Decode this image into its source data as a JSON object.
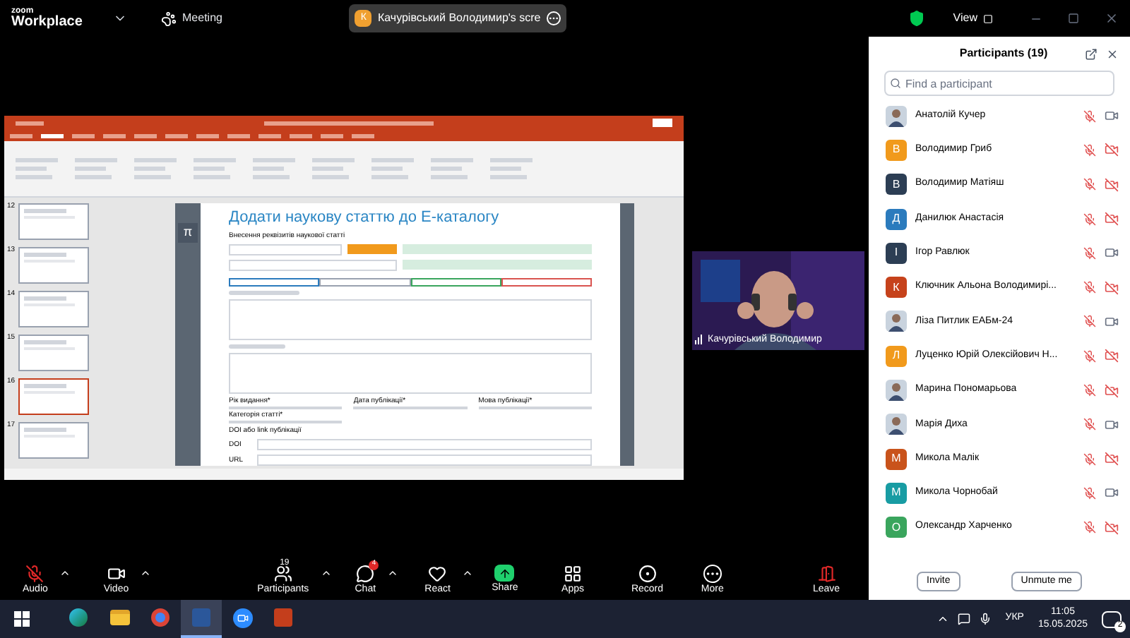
{
  "top_bar": {
    "brand_top": "zoom",
    "brand": "Workplace",
    "meeting_label": "Meeting",
    "share_pill": {
      "letter": "К",
      "label": "Качурівський Володимир's scre"
    },
    "view_label": "View"
  },
  "shared_screen": {
    "thumbnails": [
      {
        "number": "12",
        "selected": false
      },
      {
        "number": "13",
        "selected": false
      },
      {
        "number": "14",
        "selected": false
      },
      {
        "number": "15",
        "selected": false
      },
      {
        "number": "16",
        "selected": true
      },
      {
        "number": "17",
        "selected": false
      }
    ],
    "slide": {
      "icon_glyph": "π",
      "title": "Додати наукову статтю до Е-каталогу",
      "subtitle": "Внесення реквізитів наукової статті",
      "row_labels": [
        "Рік видання*",
        "Дата публікації*",
        "Мова публікації*",
        "Категорія статті*"
      ],
      "doi_heading": "DOI або link публікації",
      "link_labels": [
        "DOI",
        "URL"
      ]
    }
  },
  "video_tile": {
    "name": "Качурівський Володимир"
  },
  "toolbar": [
    {
      "kind": "audio",
      "label": "Audio",
      "muted": true
    },
    {
      "kind": "video",
      "label": "Video"
    },
    {
      "kind": "participants",
      "label": "Participants",
      "count": "19"
    },
    {
      "kind": "chat",
      "label": "Chat",
      "badge": "4"
    },
    {
      "kind": "react",
      "label": "React"
    },
    {
      "kind": "share",
      "label": "Share"
    },
    {
      "kind": "apps",
      "label": "Apps"
    },
    {
      "kind": "record",
      "label": "Record"
    },
    {
      "kind": "more",
      "label": "More"
    },
    {
      "kind": "leave",
      "label": "Leave"
    }
  ],
  "participants": {
    "title": "Participants (19)",
    "search_placeholder": "Find a participant",
    "items": [
      {
        "name": "Анатолій Кучер",
        "muted": true,
        "video_on": true
      },
      {
        "name": "Володимир  Гриб",
        "avatar": {
          "kind": "letter",
          "letter": "В",
          "color": "#f19a1c"
        },
        "muted": true,
        "video_on": false
      },
      {
        "name": "Володимир Матіяш",
        "avatar": {
          "kind": "letter",
          "letter": "В",
          "color": "#2c3e54"
        },
        "muted": true,
        "video_on": false
      },
      {
        "name": "Данилюк Анастасія",
        "avatar": {
          "kind": "letter",
          "letter": "Д",
          "color": "#2b7bbd"
        },
        "muted": true,
        "video_on": false
      },
      {
        "name": "Ігор Равлюк",
        "avatar": {
          "kind": "letter",
          "letter": "І",
          "color": "#2c3e54"
        },
        "muted": true,
        "video_on": true
      },
      {
        "name": "Ключник Альона Володимирі...",
        "avatar": {
          "kind": "letter",
          "letter": "К",
          "color": "#c6421b"
        },
        "muted": true,
        "video_on": false
      },
      {
        "name": "Ліза Питлик ЕАБм-24",
        "muted": true,
        "video_on": true
      },
      {
        "name": "Луценко Юрій Олексійович Н...",
        "avatar": {
          "kind": "letter",
          "letter": "Л",
          "color": "#f19a1c"
        },
        "muted": true,
        "video_on": false
      },
      {
        "name": "Марина Пономарьова",
        "muted": true,
        "video_on": false
      },
      {
        "name": "Марія Диха",
        "muted": true,
        "video_on": true
      },
      {
        "name": "Микола Малік",
        "avatar": {
          "kind": "letter",
          "letter": "М",
          "color": "#c9531b"
        },
        "muted": true,
        "video_on": false
      },
      {
        "name": "Микола Чорнобай",
        "avatar": {
          "kind": "letter",
          "letter": "М",
          "color": "#189ca3"
        },
        "muted": true,
        "video_on": true
      },
      {
        "name": "Олександр Харченко",
        "avatar": {
          "kind": "letter",
          "letter": "О",
          "color": "#3aa55d"
        },
        "muted": true,
        "video_on": false
      }
    ],
    "buttons": [
      "Invite",
      "Unmute me"
    ]
  },
  "taskbar": {
    "apps": [
      {
        "kind": "edge",
        "selected": false
      },
      {
        "kind": "explorer",
        "selected": false
      },
      {
        "kind": "chrome",
        "selected": false
      },
      {
        "kind": "word",
        "selected": true
      },
      {
        "kind": "zoom",
        "selected": false
      },
      {
        "kind": "powerpoint",
        "selected": false
      }
    ],
    "language": "УКР",
    "time": "11:05",
    "date": "15.05.2025",
    "notifications": "2"
  }
}
